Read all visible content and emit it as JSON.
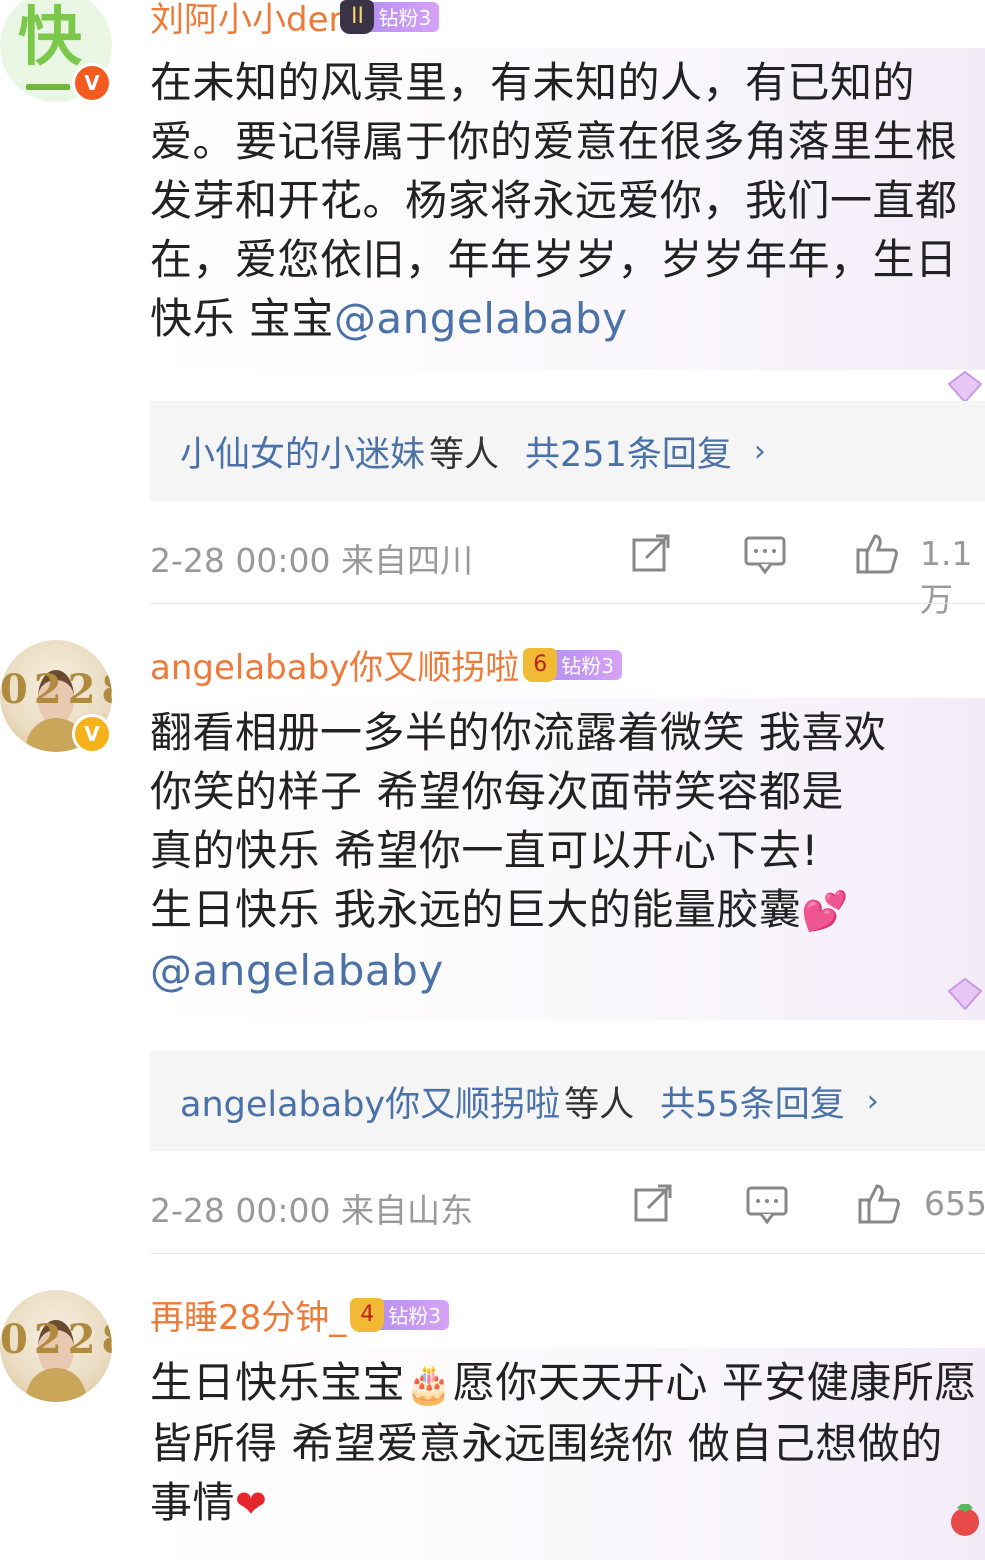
{
  "comments": [
    {
      "username": "刘阿小小der",
      "badge_label": "钻粉3",
      "badge_level": "II",
      "avatar_glyph": "快",
      "text": "在未知的风景里，有未知的人，有已知的爱。要记得属于你的爱意在很多角落里生根发芽和开花。杨家将永远爱你，我们一直都在，爱您依旧，年年岁岁，岁岁年年，生日快乐 宝宝",
      "mention": "@angelababy",
      "reply_names": "小仙女的小迷妹",
      "reply_suffix": "等人",
      "reply_count": "共251条回复",
      "reply_arrow": "›",
      "meta": "2-28 00:00  来自四川",
      "likes": "1.1万"
    },
    {
      "username": "angelababy你又顺拐啦",
      "badge_label": "钻粉3",
      "badge_level": "6",
      "avatar_date": "0228",
      "text_lines": [
        "翻看相册一多半的你流露着微笑 我喜欢",
        "你笑的样子 希望你每次面带笑容都是",
        "真的快乐 希望你一直可以开心下去!",
        "生日快乐 我永远的巨大的能量胶囊"
      ],
      "emoji": "💕",
      "mention": "@angelababy",
      "reply_names": "angelababy你又顺拐啦",
      "reply_suffix": "等人",
      "reply_count": "共55条回复",
      "reply_arrow": "›",
      "meta": "2-28 00:00  来自山东",
      "likes": "655"
    },
    {
      "username": "再睡28分钟_",
      "badge_label": "钻粉3",
      "badge_level": "4",
      "avatar_date": "0228",
      "text_a": "生日快乐宝宝",
      "emoji_a": "🎂",
      "text_b": "愿你天天开心 平安健康所愿皆所得 希望爱意永远围绕你 做自己想做的事情",
      "emoji_b": "❤"
    }
  ],
  "icons": [
    "share-icon",
    "comment-icon",
    "like-icon",
    "verified-icon",
    "crown-icon"
  ]
}
